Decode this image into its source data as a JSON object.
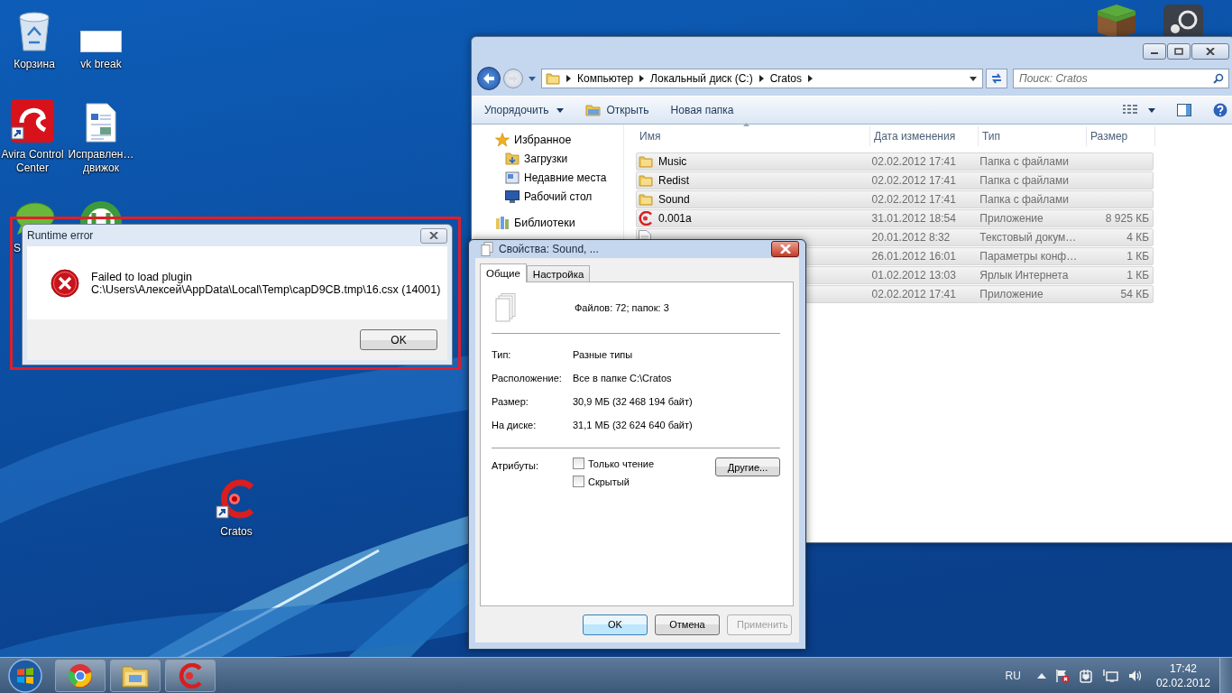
{
  "desktop": {
    "icons": [
      {
        "kind": "recycle",
        "label": "Корзина"
      },
      {
        "kind": "blank",
        "label": "vk break"
      },
      {
        "kind": "avira",
        "label": "Avira Control Center"
      },
      {
        "kind": "document",
        "label": "Исправлен… движок"
      },
      {
        "kind": "dcpp",
        "label": "S"
      },
      {
        "kind": "utorrent"
      },
      {
        "kind": "cratos",
        "label": "Cratos"
      },
      {
        "kind": "grassblock"
      },
      {
        "kind": "roundlogo"
      }
    ]
  },
  "explorer": {
    "address": {
      "crumbs": [
        "Компьютер",
        "Локальный диск (C:)",
        "Cratos"
      ]
    },
    "search": {
      "placeholder": "Поиск: Cratos"
    },
    "toolbar": [
      {
        "kind": "menu",
        "label": "Упорядочить"
      },
      {
        "kind": "open",
        "label": "Открыть"
      },
      {
        "kind": "plain",
        "label": "Новая папка"
      }
    ],
    "nav": [
      {
        "kind": "favorites",
        "label": "Избранное",
        "children": [
          {
            "kind": "downloads",
            "label": "Загрузки"
          },
          {
            "kind": "recent",
            "label": "Недавние места"
          },
          {
            "kind": "desktop",
            "label": "Рабочий стол"
          }
        ]
      },
      {
        "kind": "libraries",
        "label": "Библиотеки"
      }
    ],
    "columns": [
      "Имя",
      "Дата изменения",
      "Тип",
      "Размер"
    ],
    "rows": [
      {
        "kind": "folder",
        "name": "Music",
        "modified": "02.02.2012 17:41",
        "type": "Папка с файлами",
        "selected": true
      },
      {
        "kind": "folder",
        "name": "Redist",
        "modified": "02.02.2012 17:41",
        "type": "Папка с файлами",
        "selected": true
      },
      {
        "kind": "folder",
        "name": "Sound",
        "modified": "02.02.2012 17:41",
        "type": "Папка с файлами",
        "selected": true
      },
      {
        "kind": "app",
        "name": "0.001a",
        "modified": "31.01.2012 18:54",
        "type": "Приложение",
        "size": "8 925 КБ",
        "selected": true
      },
      {
        "kind": "text",
        "modified": "20.01.2012 8:32",
        "type": "Текстовый докум…",
        "size": "4 КБ",
        "selected": true
      },
      {
        "kind": "hidden",
        "modified": "26.01.2012 16:01",
        "type": "Параметры конф…",
        "size": "1 КБ",
        "selected": true
      },
      {
        "kind": "hidden",
        "modified": "01.02.2012 13:03",
        "type": "Ярлык Интернета",
        "size": "1 КБ",
        "selected": true
      },
      {
        "kind": "hidden",
        "modified": "02.02.2012 17:41",
        "type": "Приложение",
        "size": "54 КБ",
        "selected": true
      }
    ]
  },
  "properties": {
    "title": "Свойства: Sound, ...",
    "tabs": [
      {
        "label": "Общие",
        "selected": true
      },
      {
        "label": "Настройка",
        "selected": false
      }
    ],
    "summary": "Файлов: 72; папок: 3",
    "fields": [
      {
        "label": "Тип:",
        "value": "Разные типы"
      },
      {
        "label": "Расположение:",
        "value": "Все в папке C:\\Cratos"
      }
    ],
    "sizes": [
      {
        "label": "Размер:",
        "value": "30,9 МБ (32 468 194 байт)"
      },
      {
        "label": "На диске:",
        "value": "31,1 МБ (32 624 640 байт)"
      }
    ],
    "attributes_label": "Атрибуты:",
    "attributes": [
      {
        "label": "Только чтение",
        "checked": false
      },
      {
        "label": "Скрытый",
        "checked": false
      }
    ],
    "more_button": "Другие...",
    "buttons": [
      {
        "label": "OK",
        "default": true,
        "disabled": false
      },
      {
        "label": "Отмена",
        "default": false,
        "disabled": false
      },
      {
        "label": "Применить",
        "default": false,
        "disabled": true
      }
    ]
  },
  "error_dialog": {
    "title": "Runtime error",
    "highlighted": true,
    "message": [
      "Failed to load plugin",
      "C:\\Users\\Алексей\\AppData\\Local\\Temp\\capD9CB.tmp\\16.csx (14001)"
    ],
    "button": "OK"
  },
  "taskbar": {
    "pinned": [
      {
        "kind": "chrome"
      },
      {
        "kind": "explorer"
      },
      {
        "kind": "cratos"
      }
    ],
    "language": "RU",
    "tray": [
      {
        "kind": "arrow"
      },
      {
        "kind": "flag"
      },
      {
        "kind": "power"
      },
      {
        "kind": "network"
      },
      {
        "kind": "volume"
      }
    ],
    "time": "17:42",
    "date": "02.02.2012"
  }
}
